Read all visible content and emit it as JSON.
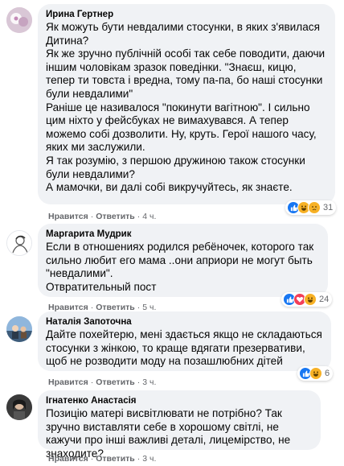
{
  "comments": [
    {
      "author": "Ирина Гертнер",
      "text": "Як можуть бути невдалими стосунки, в яких з'явилася Дитина?\nЯк же зручно публічній особі так себе поводити, даючи іншим чоловікам зразок поведінки. \"Знаєш, кицю, тепер ти товста і вредна, тому па-па, бо наші стосунки були невдалими\"\nРаніше це називалося \"покинути вагітною\". І сильно цим ніхто у фейсбуках не вимахувався. А тепер можемо собі дозволити. Ну, круть. Герої нашого часу, яких ми заслужили.\nЯ так розумію, з першою дружиною також стосунки були невдалими?\nА мамочки, ви далі собі викручуйтесь, як знаєте.",
      "like_label": "Нравится",
      "reply_label": "Ответить",
      "time": "4 ч.",
      "reaction_count": "31",
      "reaction_icons": [
        "like-icon",
        "haha-icon",
        "sad-icon"
      ]
    },
    {
      "author": "Маргарита Мудрик",
      "text": "Если в отношениях родился ребёночек, которого так сильно любит его мама ..они априори не могут быть \"невдалими\".\nОтвратительный пост",
      "like_label": "Нравится",
      "reply_label": "Ответить",
      "time": "5 ч.",
      "reaction_count": "24",
      "reaction_icons": [
        "like-icon",
        "love-icon",
        "haha-icon"
      ]
    },
    {
      "author": "Наталія Запоточна",
      "text": "Дайте похейтерю, мені здається якщо не складаються стосунки з жінкою, то краще вдягати презервативи, щоб не розводити моду на позашлюбних дітей",
      "like_label": "Нравится",
      "reply_label": "Ответить",
      "time": "3 ч.",
      "reaction_count": "6",
      "reaction_icons": [
        "like-icon",
        "haha-icon"
      ]
    },
    {
      "author": "Ігнатенко Анастасія",
      "text": "Позицію матері висвітлювати не потрібно? Так зручно виставляти себе в хорошому світлі, не кажучи про інші важливі деталі, лицемірство, не знаходите?",
      "like_label": "Нравится",
      "reply_label": "Ответить",
      "time": "3 ч."
    }
  ],
  "colors": {
    "bubble": "#f0f2f5",
    "meta": "#65676b",
    "like": "#1877f2",
    "love": "#f33e58",
    "haha": "#f7b125"
  }
}
